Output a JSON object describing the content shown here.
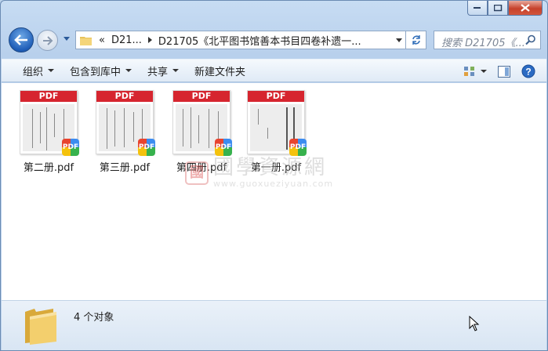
{
  "address_bar": {
    "parts": [
      "«",
      "D21...",
      "D21705《北平图书馆善本书目四卷补遗一..."
    ]
  },
  "search": {
    "placeholder": "搜索 D21705《..."
  },
  "toolbar": {
    "organize": "组织",
    "include_library": "包含到库中",
    "share": "共享",
    "new_folder": "新建文件夹"
  },
  "files": [
    {
      "name": "第二册.pdf",
      "thumb_label": "PDF",
      "badge": "PDF"
    },
    {
      "name": "第三册.pdf",
      "thumb_label": "PDF",
      "badge": "PDF"
    },
    {
      "name": "第四册.pdf",
      "thumb_label": "PDF",
      "badge": "PDF"
    },
    {
      "name": "第一册.pdf",
      "thumb_label": "PDF",
      "badge": "PDF"
    }
  ],
  "watermark": {
    "seal": "國",
    "title": "國學資源網",
    "url": "www.guoxueziyuan.com"
  },
  "status": {
    "count_text": "4 个对象"
  },
  "colors": {
    "pdf_red": "#d6252f",
    "window_frame": "#c7dcf3",
    "close_red": "#c6412b"
  }
}
